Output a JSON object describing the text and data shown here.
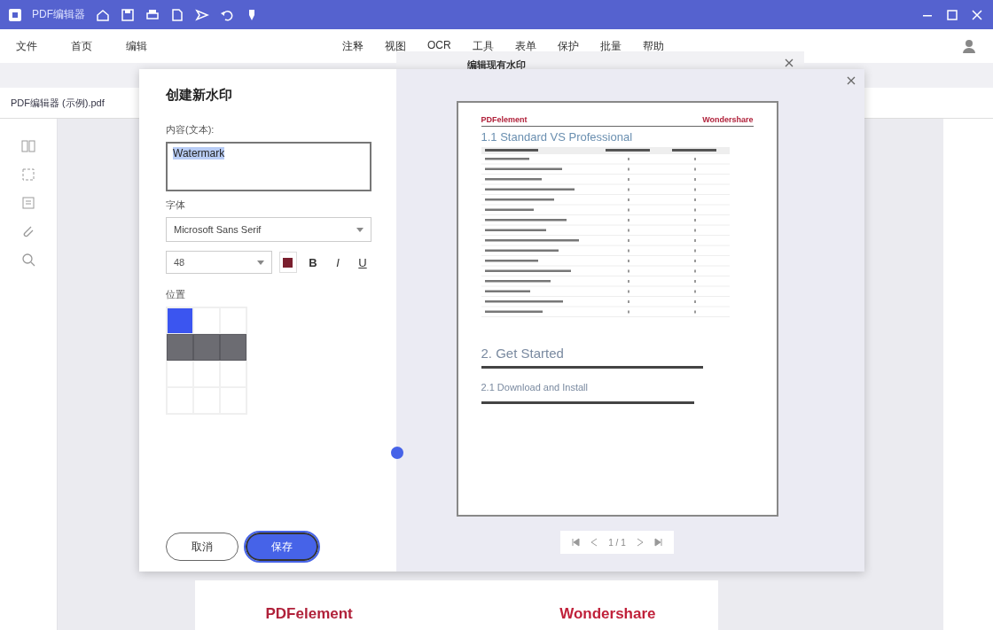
{
  "window": {
    "title": "PDF编辑器"
  },
  "menu_left": [
    "文件",
    "首页",
    "编辑"
  ],
  "menu_right": [
    "注释",
    "视图",
    "OCR",
    "工具",
    "表单",
    "保护",
    "批量",
    "帮助"
  ],
  "document_tab": {
    "label": "PDF编辑器 (示例).pdf"
  },
  "background_page": {
    "logo": "PDFelement",
    "brand": "Wondershare"
  },
  "back_dialog": {
    "title": "编辑现有水印"
  },
  "dialog": {
    "title": "创建新水印",
    "content_label": "内容(文本):",
    "content_value": "Watermark",
    "content_selected": true,
    "font_label": "字体",
    "font": "Microsoft Sans Serif",
    "size": "48",
    "text_colors": [
      {
        "color": "#7a1f2e"
      }
    ],
    "bold": "B",
    "italic": "I",
    "underline": "U",
    "position_label": "位置",
    "position_grid": [
      [
        {
          "selected": true,
          "filled": false
        },
        {
          "selected": false,
          "filled": false
        },
        {
          "selected": false,
          "filled": false
        }
      ],
      [
        {
          "selected": false,
          "filled": true
        },
        {
          "selected": false,
          "filled": true
        },
        {
          "selected": false,
          "filled": true
        }
      ],
      [
        {
          "selected": false,
          "filled": false
        },
        {
          "selected": false,
          "filled": false
        },
        {
          "selected": false,
          "filled": false
        }
      ],
      [
        {
          "selected": false,
          "filled": false
        },
        {
          "selected": false,
          "filled": false
        },
        {
          "selected": false,
          "filled": false
        }
      ]
    ],
    "buttons": [
      {
        "label": "取消",
        "kind": "secondary"
      },
      {
        "label": "保存",
        "kind": "primary"
      }
    ]
  },
  "preview": {
    "logo": "PDFelement",
    "brand": "Wondershare",
    "headings": [
      "1.1 Standard VS Professional",
      "2. Get Started",
      "2.1 Download and Install"
    ],
    "page": "1 / 1"
  }
}
